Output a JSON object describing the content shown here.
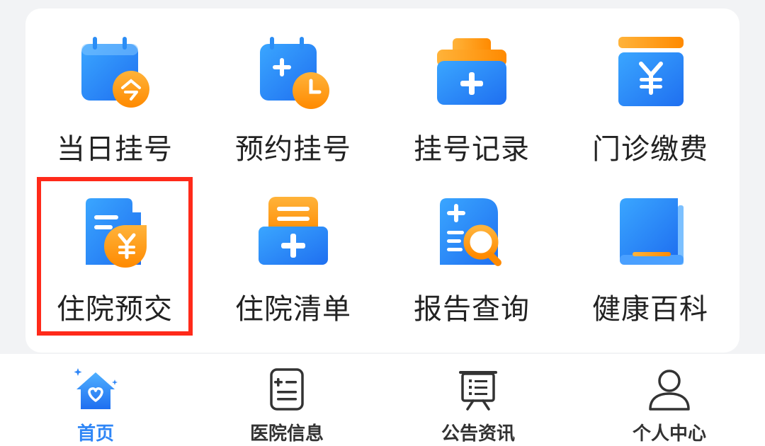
{
  "grid": {
    "items": [
      {
        "label": "当日挂号",
        "icon": "calendar-today-icon"
      },
      {
        "label": "预约挂号",
        "icon": "calendar-clock-icon"
      },
      {
        "label": "挂号记录",
        "icon": "record-folder-icon"
      },
      {
        "label": "门诊缴费",
        "icon": "payment-yen-icon"
      },
      {
        "label": "住院预交",
        "icon": "document-yen-icon"
      },
      {
        "label": "住院清单",
        "icon": "list-plus-icon"
      },
      {
        "label": "报告查询",
        "icon": "report-search-icon"
      },
      {
        "label": "健康百科",
        "icon": "book-icon"
      }
    ],
    "highlighted_item": "住院预交"
  },
  "tabbar": {
    "tabs": [
      {
        "label": "首页",
        "icon": "home-heart-icon",
        "active": true
      },
      {
        "label": "医院信息",
        "icon": "hospital-info-icon",
        "active": false
      },
      {
        "label": "公告资讯",
        "icon": "notice-board-icon",
        "active": false
      },
      {
        "label": "个人中心",
        "icon": "person-icon",
        "active": false
      }
    ]
  },
  "colors": {
    "primary_blue": "#2f86f6",
    "accent_orange": "#ff9a1a",
    "highlight_red": "#ff2a1a"
  }
}
